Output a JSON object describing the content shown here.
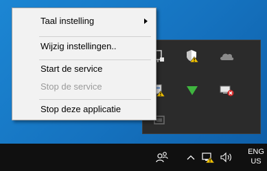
{
  "context_menu": {
    "items": [
      {
        "label": "Taal instelling",
        "has_submenu": true,
        "enabled": true
      },
      {
        "label": "Wijzig instellingen..",
        "enabled": true
      },
      {
        "label": "Start de service",
        "enabled": true
      },
      {
        "label": "Stop de service",
        "enabled": false
      },
      {
        "label": "Stop deze applicatie",
        "enabled": true
      }
    ]
  },
  "tray_overflow": {
    "icons": [
      "usb-device-icon",
      "windows-security-warning-icon",
      "onedrive-cloud-icon",
      "battery-warning-icon",
      "green-arrow-down-icon",
      "network-error-icon",
      "monitor-icon"
    ]
  },
  "taskbar": {
    "icons": [
      "people-icon",
      "show-hidden-icons-chevron",
      "network-warning-icon",
      "volume-icon"
    ],
    "language": {
      "line1": "ENG",
      "line2": "US"
    }
  },
  "colors": {
    "menu_bg": "#f2f2f2",
    "disabled_text": "#9a9a9a",
    "taskbar_bg": "#101010",
    "flyout_bg": "#2b2b2b",
    "wallpaper": "#1a7ec8"
  }
}
